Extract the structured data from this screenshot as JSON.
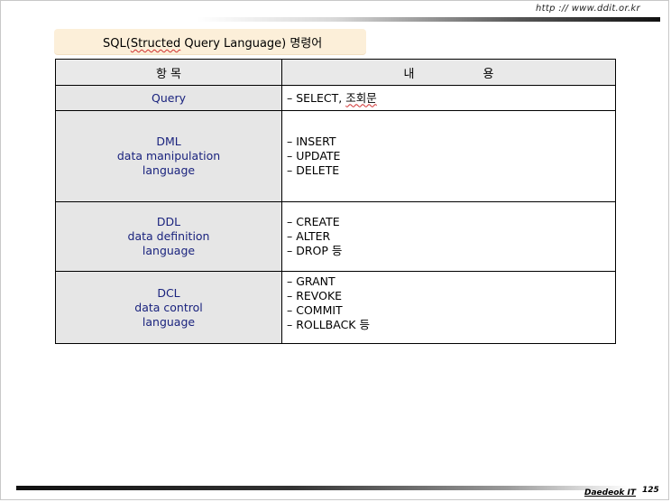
{
  "header": {
    "url": "http :// www.ddit.or.kr"
  },
  "title": {
    "prefix": "SQL(",
    "squiggle": "Structed",
    "suffix": " Query Language) 명령어"
  },
  "table": {
    "header_left": "항 목",
    "header_right": "내 용",
    "rows": [
      {
        "left": [
          "Query"
        ],
        "right": [
          "– SELECT, 조회문"
        ]
      },
      {
        "left": [
          "DML",
          "data manipulation",
          "language"
        ],
        "right": [
          "– INSERT",
          "– UPDATE",
          "– DELETE"
        ]
      },
      {
        "left": [
          "DDL",
          "data definition",
          "language"
        ],
        "right": [
          "– CREATE",
          "– ALTER",
          "– DROP 등"
        ]
      },
      {
        "left": [
          "DCL",
          "data control",
          "language"
        ],
        "right": [
          "– GRANT",
          "–  REVOKE",
          "–  COMMIT",
          "–  ROLLBACK 등"
        ]
      }
    ]
  },
  "footer": {
    "brand": "Daedeok IT",
    "page_number": "125"
  }
}
